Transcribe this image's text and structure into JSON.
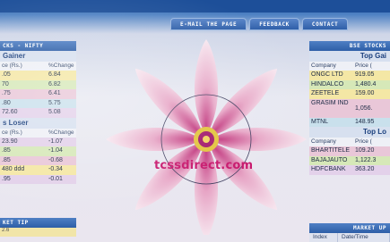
{
  "top_strip": "",
  "tabs": [
    {
      "label": "E-MAIL THE PAGE"
    },
    {
      "label": "FEEDBACK"
    },
    {
      "label": "CONTACT"
    }
  ],
  "left_panel": {
    "header": "CKS - NIFTY",
    "gainers": {
      "title": "Gainer",
      "col_price": "ce (Rs.)",
      "col_change": "%Change",
      "rows": [
        {
          "price": ".05",
          "change": "6.84"
        },
        {
          "price": "70",
          "change": "6.82"
        },
        {
          "price": ".75",
          "change": "6.41"
        },
        {
          "price": ".80",
          "change": "5.75"
        },
        {
          "price": "72.60",
          "change": "5.08"
        }
      ]
    },
    "losers": {
      "title": "s Loser",
      "col_price": "ce (Rs.)",
      "col_change": "%Change",
      "rows": [
        {
          "price": "23.90",
          "change": "-1.07"
        },
        {
          "price": ".85",
          "change": "-1.04"
        },
        {
          "price": ".85",
          "change": "-0.68"
        },
        {
          "price": "480 ddd",
          "change": "-0.34"
        },
        {
          "price": ".95",
          "change": "-0.01"
        }
      ]
    }
  },
  "left_bottom": {
    "header": "KET TIP",
    "value": "2.6"
  },
  "right_panel": {
    "header": "BSE STOCKS",
    "gainers": {
      "title": "Top Gai",
      "col_company": "Company",
      "col_price": "Price (",
      "rows": [
        {
          "company": "ONGC LTD",
          "price": "919.05"
        },
        {
          "company": "HINDALCO",
          "price": "1,480.4"
        },
        {
          "company": "ZEETELE",
          "price": "159.00"
        },
        {
          "company": "GRASIM IND",
          "price": "1,056."
        },
        {
          "company": "MTNL",
          "price": "148.95"
        }
      ]
    },
    "losers": {
      "title": "Top Lo",
      "col_company": "Company",
      "col_price": "Price (",
      "rows": [
        {
          "company": "BHARTITELE",
          "price": "109.20"
        },
        {
          "company": "BAJAJAUTO",
          "price": "1,122.3"
        },
        {
          "company": "HDFCBANK",
          "price": "363.20"
        }
      ]
    }
  },
  "right_bottom": {
    "header": "MARKET UP",
    "col_index": "Index",
    "col_date": "Date/Time"
  },
  "center": {
    "logo_text": "tcssdirect.com"
  },
  "colors": {
    "accent_blue": "#2d5ea7",
    "logo_magenta": "#c7166c"
  }
}
